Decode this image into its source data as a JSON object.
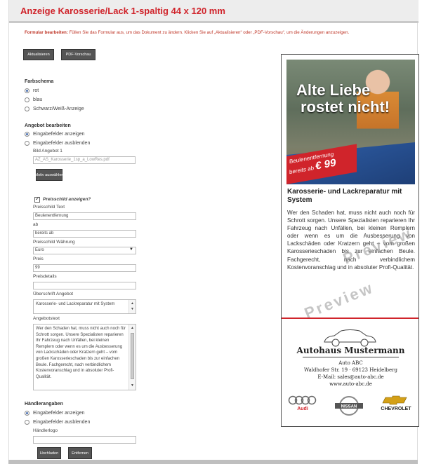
{
  "header": {
    "title": "Anzeige Karosserie/Lack 1-spaltig 44 x 120 mm"
  },
  "notice": {
    "label": "Formular bearbeiten:",
    "text": "Füllen Sie das Formular aus, um das Dokument zu ändern. Klicken Sie auf „Aktualisieren“ oder „PDF-Vorschau“, um die Änderungen anzuzeigen."
  },
  "toolbar": {
    "refresh": "Aktualisieren",
    "pdf_preview": "PDF-Vorschau"
  },
  "color_scheme": {
    "title": "Farbschema",
    "options": [
      "rot",
      "blau",
      "Schwarz/Weiß-Anzeige"
    ],
    "selected": "rot"
  },
  "offer": {
    "title": "Angebot bearbeiten",
    "options": [
      "Eingabefelder anzeigen",
      "Eingabefelder ausblenden"
    ],
    "selected": "Eingabefelder anzeigen",
    "image_label": "Bild Angebot 1",
    "image_value": "AZ_AS_Karosserie_1sp_a_LowRes.pdf",
    "choose_motif": "Motiv auswählen",
    "price_tag_check": "Preisschild anzeigen?",
    "price_tag_text_label": "Preisschild Text",
    "price_tag_text": "Beulenentfernung",
    "ab_label": "ab",
    "ab_value": "bereits ab",
    "currency_label": "Preisschild Währung",
    "currency": "Euro",
    "price_label": "Preis",
    "price": "99",
    "price_details_label": "Preisdetails",
    "price_details": "",
    "headline_label": "Überschrift Angebot",
    "headline_value": "Karosserie- und Lackreparatur mit System",
    "text_label": "Angebotstext",
    "text_value": "Wer den Schaden hat, muss nicht auch noch für Schrott sorgen. Unsere Spezialisten reparieren Ihr Fahrzeug nach Unfällen, bei kleinen Remplern oder wenn es um die Ausbesserung von Lackschäden oder Kratzern geht – vom großen Karosserieschaden bis zur einfachen Beule. Fachgerecht, nach verbindlichem Kostenvoranschlag und in absoluter Profi-Qualität."
  },
  "dealer": {
    "title": "Händlerangaben",
    "options": [
      "Eingabefelder anzeigen",
      "Eingabefelder ausblenden"
    ],
    "selected": "Eingabefelder anzeigen",
    "logo_label": "Händlerlogo",
    "logo_value": "",
    "upload": "Hochladen",
    "remove": "Entfernen"
  },
  "ad": {
    "headline_1": "Alte Liebe",
    "headline_2": "rostet nicht!",
    "ribbon_1": "Beulenentfernung",
    "ribbon_2": "bereits ab",
    "ribbon_price": "€ 99",
    "title": "Karosserie- und Lackreparatur mit System",
    "body": "Wer den Schaden hat, muss nicht auch noch für Schrott sorgen. Unsere Spezialisten reparieren Ihr Fahrzeug nach Unfällen, bei kleinen Remplern oder wenn es um die Ausbesserung von Lackschäden oder Kratzern geht – vom großen Karosserieschaden bis zur einfachen Beule. Fachgerecht, nach verbindlichem Kostenvoranschlag und in absoluter Profi-Qualität.",
    "watermark": "Preview",
    "dealer_name": "Autohaus Mustermann",
    "address_1": "Auto ABC",
    "address_2": "Waldhofer Str. 19 · 69123 Heidelberg",
    "address_3": "E-Mail: sales@auto-abc.de",
    "address_4": "www.auto-abc.de",
    "brands": [
      "Audi",
      "NISSAN",
      "CHEVROLET"
    ],
    "brand_colors": {
      "audi": "#d0242b",
      "chevrolet": "#d4a017"
    }
  },
  "colors": {
    "accent": "#d0242b",
    "button": "#555555"
  }
}
